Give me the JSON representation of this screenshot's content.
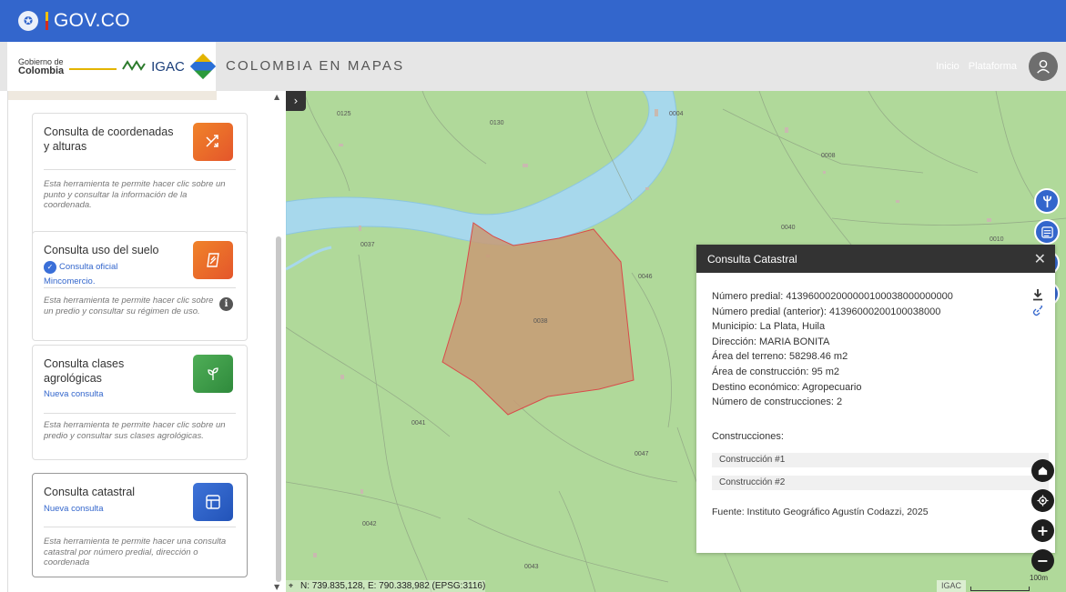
{
  "govbar": {
    "brand": "GOV.CO"
  },
  "header": {
    "logo_gobierno_small": "Gobierno de",
    "logo_gobierno_big": "Colombia",
    "logo_igac": "IGAC",
    "title": "COLOMBIA EN MAPAS",
    "nav": [
      {
        "label": "Inicio"
      },
      {
        "label": "Plataforma"
      }
    ]
  },
  "sidebar": {
    "cards": [
      {
        "title": "Consulta de coordenadas y alturas",
        "subtitle": "",
        "subtitle2": "",
        "description": "Esta herramienta te permite hacer clic sobre un punto y consultar la información de la coordenada.",
        "icon": "shuffle-icon",
        "tile_color": "#ec6a2c"
      },
      {
        "title": "Consulta uso del suelo",
        "subtitle": "Consulta oficial",
        "subtitle2": "Mincomercio.",
        "description": "Esta herramienta te permite hacer clic sobre un predio y consultar su régimen de uso.",
        "icon": "land-use-icon",
        "tile_color": "#ec6a2c"
      },
      {
        "title": "Consulta clases agrológicas",
        "subtitle": "Nueva consulta",
        "subtitle2": "",
        "description": "Esta herramienta te permite hacer clic sobre un predio y consultar sus clases agrológicas.",
        "icon": "sprout-icon",
        "tile_color": "#3f9e4b"
      },
      {
        "title": "Consulta catastral",
        "subtitle": "Nueva consulta",
        "subtitle2": "",
        "description": "Esta herramienta te permite hacer una consulta catastral por número predial, dirección o coordenada",
        "icon": "layout-icon",
        "tile_color": "#2c5fc9"
      }
    ]
  },
  "map": {
    "parcel_labels": [
      "0125",
      "0130",
      "0004",
      "0008",
      "0037",
      "0040",
      "0010",
      "0046",
      "0038",
      "0041",
      "0047",
      "0042",
      "0043"
    ],
    "coords": "N: 739.835,128, E: 790.338,982 (EPSG:3116)",
    "attribution": "IGAC",
    "scale": "100m",
    "colors": {
      "land": "#b0d99a",
      "river": "#a7d8ec",
      "parcel": "#c89a74",
      "parcel_border": "#d94a4a"
    }
  },
  "panel": {
    "title": "Consulta Catastral",
    "lines": [
      "Número predial: 413960002000000100038000000000",
      "Número predial (anterior): 41396000200100038000",
      "Municipio: La Plata, Huila",
      "Dirección: MARIA BONITA",
      "Área del terreno: 58298.46 m2",
      "Área de construcción: 95 m2",
      "Destino económico: Agropecuario",
      "Número de construcciones: 2"
    ],
    "constructions_heading": "Construcciones:",
    "constructions": [
      "Construcción #1",
      "Construcción #2"
    ],
    "source": "Fuente: Instituto Geográfico Agustín Codazzi, 2025"
  }
}
